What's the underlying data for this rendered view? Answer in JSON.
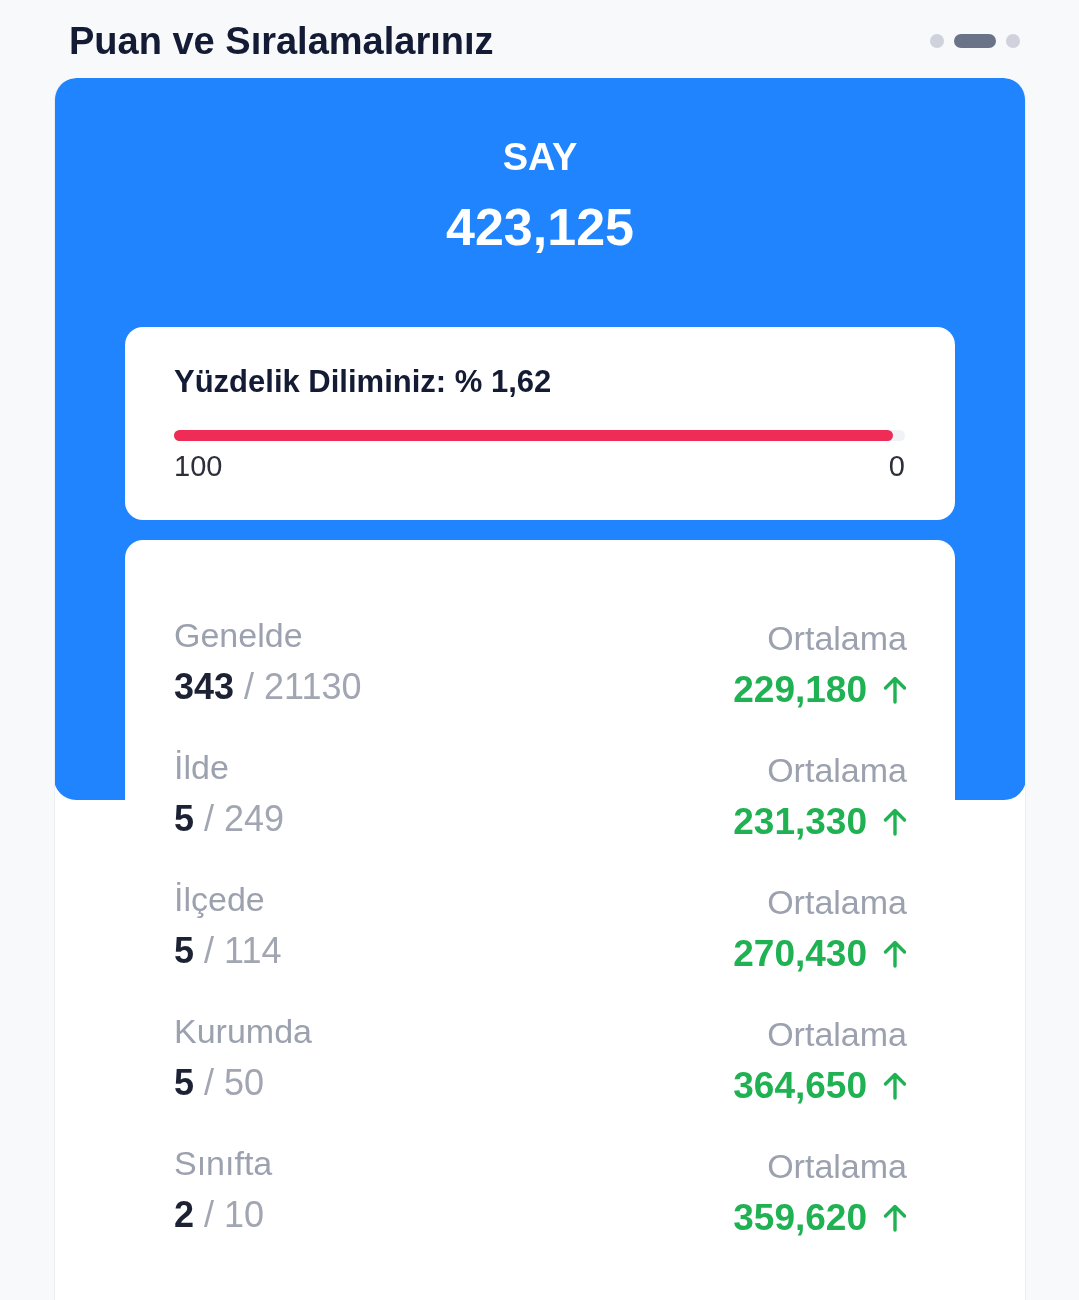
{
  "header": {
    "title": "Puan ve Sıralamalarınız",
    "pager": [
      {
        "selected": false
      },
      {
        "selected": true
      },
      {
        "selected": false
      }
    ]
  },
  "score": {
    "type": "SAY",
    "value": "423,125"
  },
  "percentile": {
    "label": "Yüzdelik Diliminiz: % 1,62",
    "level": 0.984,
    "min_label": "100",
    "max_label": "0"
  },
  "rankings": [
    {
      "label": "Genelde",
      "rank": "**343** / 21130",
      "average_label": "Ortalama",
      "average": "229,180",
      "rising": true
    },
    {
      "label": "İlde",
      "rank": "**5** / 249",
      "average_label": "Ortalama",
      "average": "231,330",
      "rising": true
    },
    {
      "label": "İlçede",
      "rank": "**5** / 114",
      "average_label": "Ortalama",
      "average": "270,430",
      "rising": true
    },
    {
      "label": "Kurumda",
      "rank": "**5** / 50",
      "average_label": "Ortalama",
      "average": "364,650",
      "rising": true
    },
    {
      "label": "Sınıfta",
      "rank": "**2** / 10",
      "average_label": "Ortalama",
      "average": "359,620",
      "rising": true
    }
  ]
}
